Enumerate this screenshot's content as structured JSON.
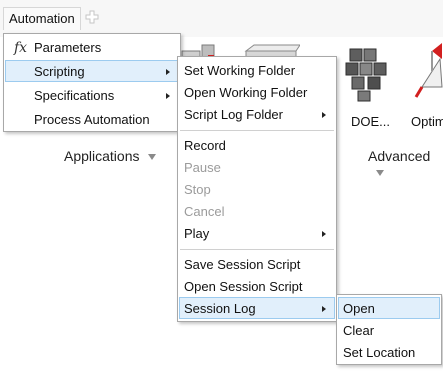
{
  "toolbar": {
    "tab_label": "Automation"
  },
  "ribbon": {
    "groups": [
      {
        "label": "Applications"
      },
      {
        "label": "Advanced"
      }
    ],
    "tools": [
      {
        "label": "DOE..."
      },
      {
        "label": "Optim"
      }
    ]
  },
  "menu_main": {
    "items": [
      {
        "label": "Parameters",
        "icon": "fx-icon"
      },
      {
        "label": "Scripting"
      },
      {
        "label": "Specifications"
      },
      {
        "label": "Process Automation"
      }
    ]
  },
  "menu_scripting": {
    "items": [
      {
        "label": "Set Working Folder"
      },
      {
        "label": "Open Working Folder"
      },
      {
        "label": "Script Log Folder"
      },
      {
        "label": "Record"
      },
      {
        "label": "Pause"
      },
      {
        "label": "Stop"
      },
      {
        "label": "Cancel"
      },
      {
        "label": "Play"
      },
      {
        "label": "Save Session Script"
      },
      {
        "label": "Open Session Script"
      },
      {
        "label": "Session Log"
      }
    ]
  },
  "menu_session_log": {
    "items": [
      {
        "label": "Open"
      },
      {
        "label": "Clear"
      },
      {
        "label": "Set Location"
      }
    ]
  },
  "colors": {
    "highlight": "#e1effb",
    "highlight_border": "#9ccbef",
    "disabled": "#9b9b9b",
    "accent_red": "#d21f1f"
  }
}
